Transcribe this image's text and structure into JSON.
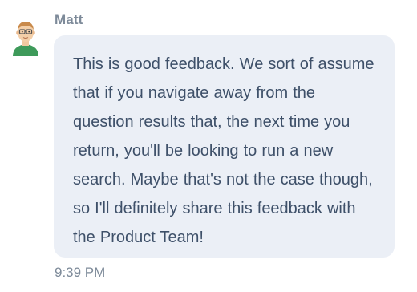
{
  "message": {
    "sender": "Matt",
    "avatar_icon": "person-with-glasses-icon",
    "text": "This is good feedback. We sort of assume that if you navigate away from the question results that, the next time you return, you'll be looking to run a new search. Maybe that's not the case though, so I'll definitely share this feedback with the Product Team!",
    "timestamp": "9:39 PM"
  },
  "colors": {
    "bubble_background": "#ebeff6",
    "message_text": "#3e5069",
    "meta_text": "#7d8a99",
    "avatar_shirt": "#3e9a5a"
  }
}
